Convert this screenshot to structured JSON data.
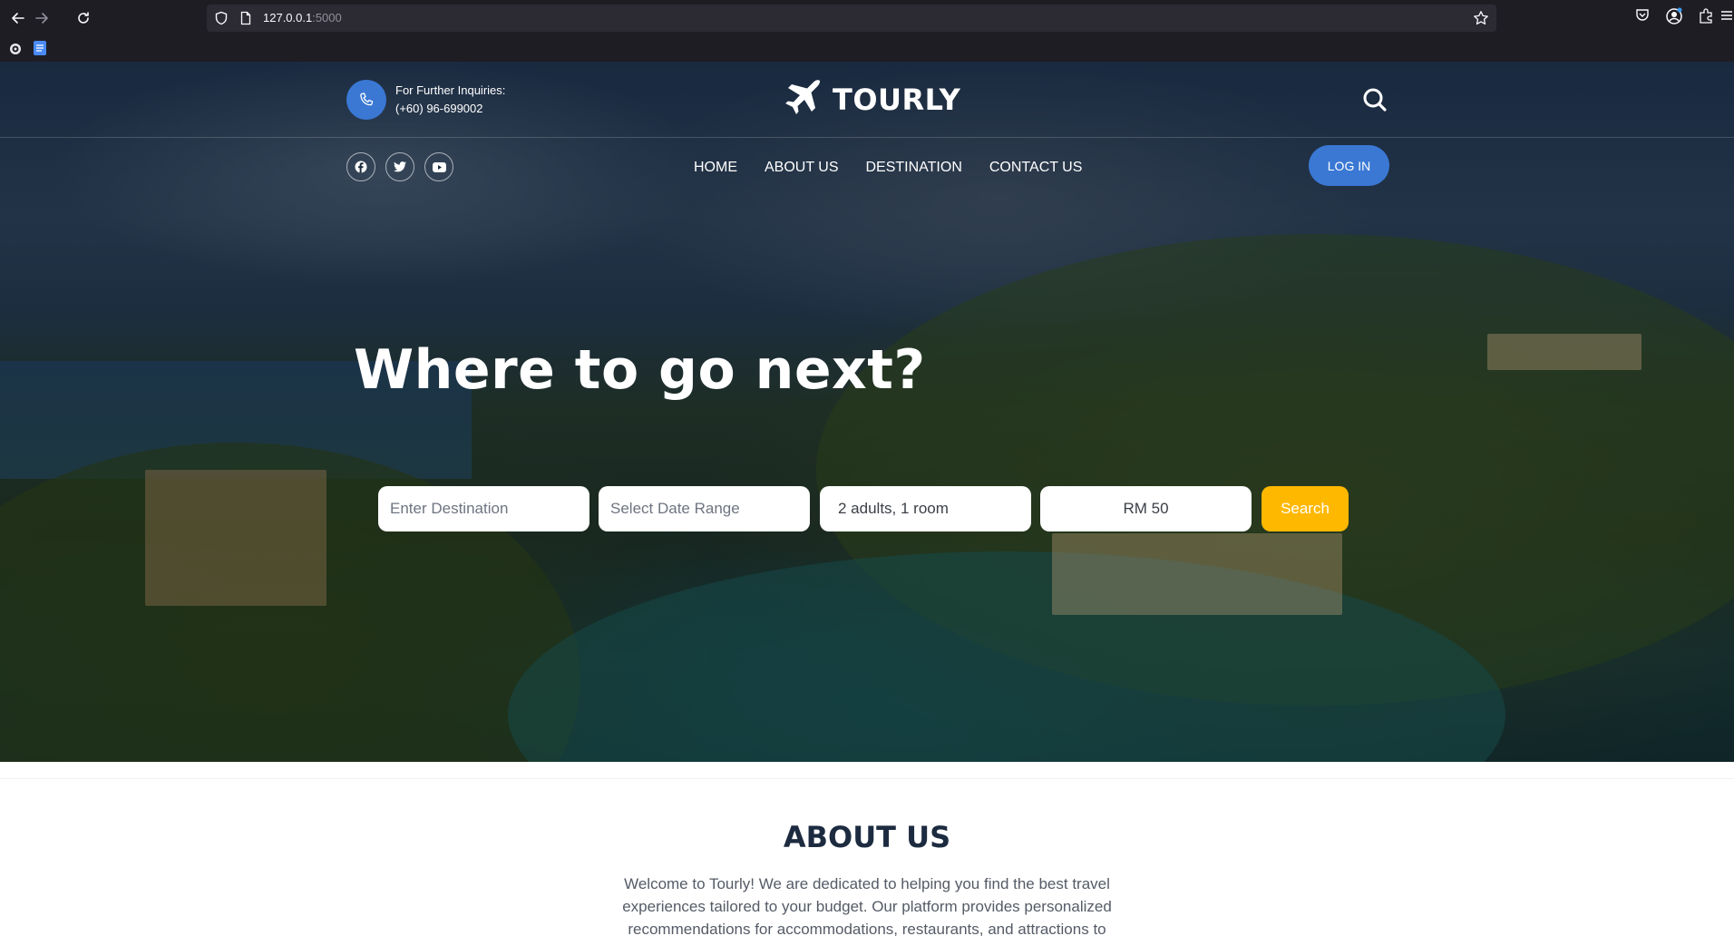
{
  "browser": {
    "url_host": "127.0.0.1",
    "url_port": ":5000"
  },
  "header": {
    "inquiries_label": "For Further Inquiries:",
    "phone": "(+60) 96-699002",
    "brand": "TOURLY",
    "login_label": "LOG IN"
  },
  "nav": {
    "items": [
      {
        "label": "HOME"
      },
      {
        "label": "ABOUT US"
      },
      {
        "label": "DESTINATION"
      },
      {
        "label": "CONTACT US"
      }
    ]
  },
  "hero": {
    "headline": "Where to go next?"
  },
  "search_form": {
    "destination_placeholder": "Enter Destination",
    "date_placeholder": "Select Date Range",
    "guests_value": "2 adults, 1 room",
    "budget_value": "RM 50",
    "search_label": "Search"
  },
  "about": {
    "title": "ABOUT US",
    "text": "Welcome to Tourly! We are dedicated to helping you find the best travel experiences tailored to your budget. Our platform provides personalized recommendations for accommodations, restaurants, and attractions to"
  },
  "colors": {
    "accent_blue": "#3a78d4",
    "search_yellow": "#ffb800",
    "title_navy": "#1d2b40"
  },
  "icons": [
    "back-icon",
    "forward-icon",
    "reload-icon",
    "shield-icon",
    "page-icon",
    "bookmark-star-icon",
    "pocket-icon",
    "account-icon",
    "extensions-icon",
    "menu-icon",
    "phone-icon",
    "plane-icon",
    "search-icon",
    "facebook-icon",
    "twitter-icon",
    "youtube-icon"
  ]
}
